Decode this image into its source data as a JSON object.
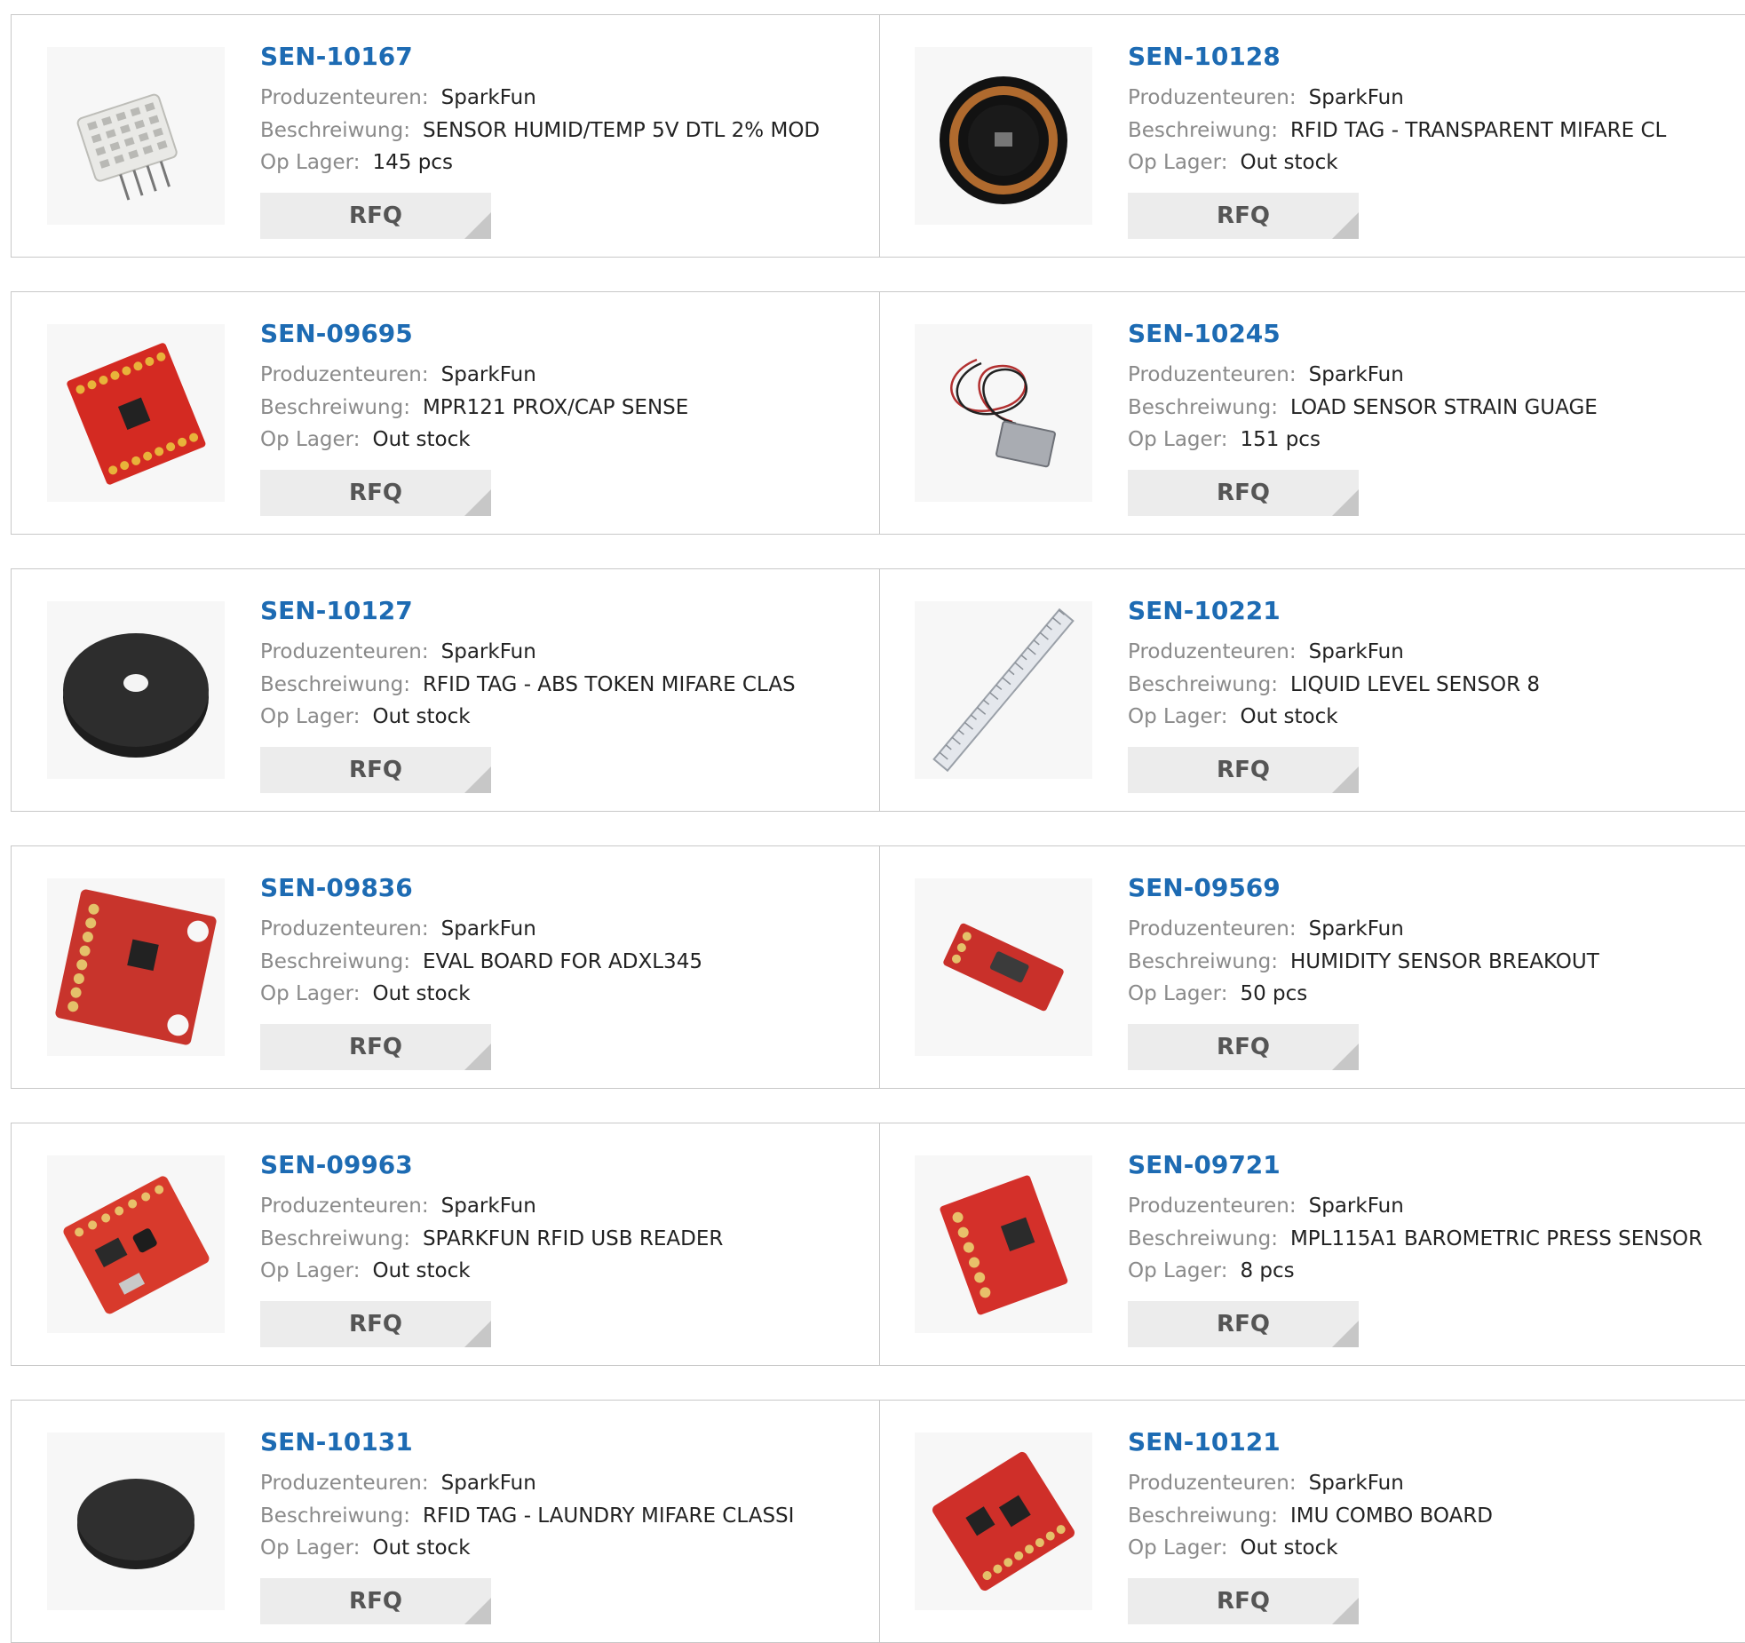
{
  "labels": {
    "manufacturer": "Produzenteuren:",
    "description": "Beschreiwung:",
    "stock": "Op Lager:",
    "rfq": "RFQ"
  },
  "products": [
    {
      "pn": "SEN-10167",
      "manufacturer": "SparkFun",
      "description": "SENSOR HUMID/TEMP 5V DTL 2% MOD",
      "stock": "145 pcs",
      "icon": "humidity-sensor-module-icon"
    },
    {
      "pn": "SEN-10128",
      "manufacturer": "SparkFun",
      "description": "RFID TAG - TRANSPARENT MIFARE CL",
      "stock": "Out stock",
      "icon": "rfid-coil-tag-icon"
    },
    {
      "pn": "SEN-09695",
      "manufacturer": "SparkFun",
      "description": "MPR121 PROX/CAP SENSE",
      "stock": "Out stock",
      "icon": "red-breakout-board-icon"
    },
    {
      "pn": "SEN-10245",
      "manufacturer": "SparkFun",
      "description": "LOAD SENSOR STRAIN GUAGE",
      "stock": "151 pcs",
      "icon": "load-sensor-icon"
    },
    {
      "pn": "SEN-10127",
      "manufacturer": "SparkFun",
      "description": "RFID TAG - ABS TOKEN MIFARE CLAS",
      "stock": "Out stock",
      "icon": "rfid-token-icon"
    },
    {
      "pn": "SEN-10221",
      "manufacturer": "SparkFun",
      "description": "LIQUID LEVEL SENSOR 8",
      "stock": "Out stock",
      "icon": "liquid-level-strip-icon"
    },
    {
      "pn": "SEN-09836",
      "manufacturer": "SparkFun",
      "description": "EVAL BOARD FOR ADXL345",
      "stock": "Out stock",
      "icon": "accelerometer-board-icon"
    },
    {
      "pn": "SEN-09569",
      "manufacturer": "SparkFun",
      "description": "HUMIDITY SENSOR BREAKOUT",
      "stock": "50 pcs",
      "icon": "humidity-breakout-icon"
    },
    {
      "pn": "SEN-09963",
      "manufacturer": "SparkFun",
      "description": "SPARKFUN RFID USB READER",
      "stock": "Out stock",
      "icon": "rfid-usb-reader-icon"
    },
    {
      "pn": "SEN-09721",
      "manufacturer": "SparkFun",
      "description": "MPL115A1 BAROMETRIC PRESS SENSOR",
      "stock": "8 pcs",
      "icon": "barometric-board-icon"
    },
    {
      "pn": "SEN-10131",
      "manufacturer": "SparkFun",
      "description": "RFID TAG - LAUNDRY MIFARE CLASSI",
      "stock": "Out stock",
      "icon": "rfid-laundry-tag-icon"
    },
    {
      "pn": "SEN-10121",
      "manufacturer": "SparkFun",
      "description": "IMU COMBO BOARD",
      "stock": "Out stock",
      "icon": "imu-board-icon"
    }
  ],
  "colors": {
    "link": "#1d6bb3",
    "label": "#8a8a8a",
    "value": "#222222",
    "button_bg": "#ececec",
    "board_red": "#d42a22"
  }
}
